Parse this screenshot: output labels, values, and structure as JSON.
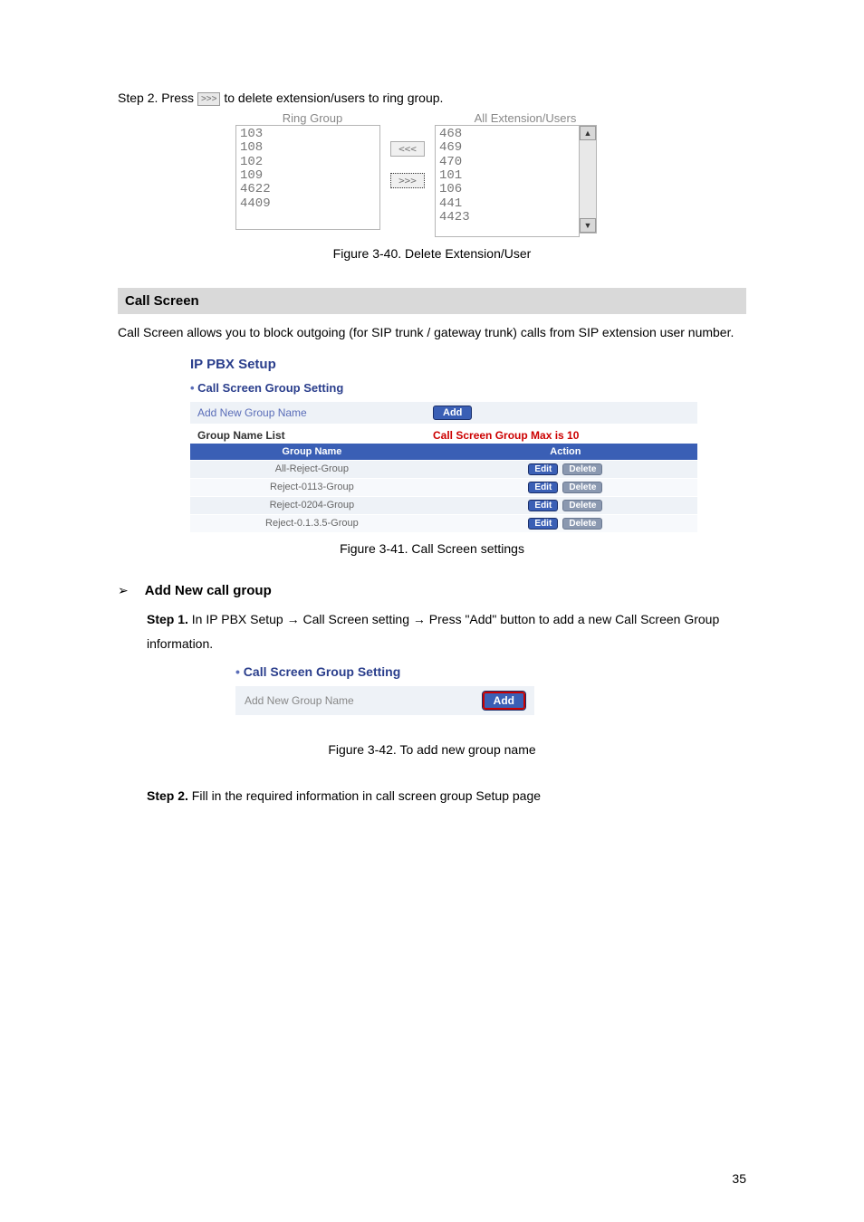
{
  "step2_line_a": "Step 2. Press ",
  "step2_line_b": " to delete extension/users to ring group.",
  "inline_btn_label": ">>>",
  "ring_group": {
    "left_label": "Ring Group",
    "right_label": "All Extension/Users",
    "left_items": "103\n108\n102\n109\n4622\n4409",
    "right_items": "468\n469\n470\n101\n106\n441\n4423",
    "btn_in": "<<<",
    "btn_out": ">>>"
  },
  "fig40": "Figure 3-40. Delete Extension/User",
  "section_call_screen": "Call Screen",
  "call_screen_para": "Call Screen allows you to block outgoing (for SIP trunk / gateway trunk) calls from SIP extension user number.",
  "ippbx": {
    "title": "IP PBX Setup",
    "subtitle": "Call Screen Group Setting",
    "add_label": "Add New Group Name",
    "add_btn": "Add",
    "group_name_list": "Group Name List",
    "max_text": "Call Screen Group Max is 10",
    "col_name": "Group Name",
    "col_action": "Action",
    "rows": [
      {
        "name": "All-Reject-Group"
      },
      {
        "name": "Reject-0113-Group"
      },
      {
        "name": "Reject-0204-Group"
      },
      {
        "name": "Reject-0.1.3.5-Group"
      }
    ],
    "edit": "Edit",
    "delete": "Delete"
  },
  "fig41": "Figure 3-41. Call Screen settings",
  "add_new_group_head": "Add New call group",
  "step1_a": "Step 1.",
  "step1_b": " In IP PBX Setup → Call Screen setting → Press \"Add\" button to add a new Call Screen Group information.",
  "csg": {
    "title": "Call Screen Group Setting",
    "label": "Add New Group Name",
    "btn": "Add"
  },
  "fig42": "Figure 3-42. To add new group name",
  "step2b_a": "Step 2.",
  "step2b_b": " Fill in the required information in call screen group Setup page",
  "page_num": "35"
}
